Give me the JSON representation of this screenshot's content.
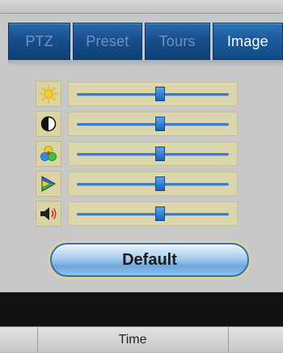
{
  "tabs": [
    {
      "label": "PTZ",
      "active": false
    },
    {
      "label": "Preset",
      "active": false
    },
    {
      "label": "Tours",
      "active": false
    },
    {
      "label": "Image",
      "active": true
    }
  ],
  "image_sliders": [
    {
      "icon": "brightness-icon",
      "level": 0.55
    },
    {
      "icon": "contrast-icon",
      "level": 0.55
    },
    {
      "icon": "saturation-icon",
      "level": 0.55
    },
    {
      "icon": "hue-icon",
      "level": 0.55
    },
    {
      "icon": "volume-icon",
      "level": 0.55
    }
  ],
  "default_button": {
    "label": "Default"
  },
  "table": {
    "column_header": "Time"
  },
  "colors": {
    "tab_active_text": "#ffffff",
    "tab_inactive_text": "#6e92c2",
    "tab_bg": "#174f8c",
    "slider_track": "#3d7ecb",
    "slider_thumb": "#1b63b5"
  }
}
